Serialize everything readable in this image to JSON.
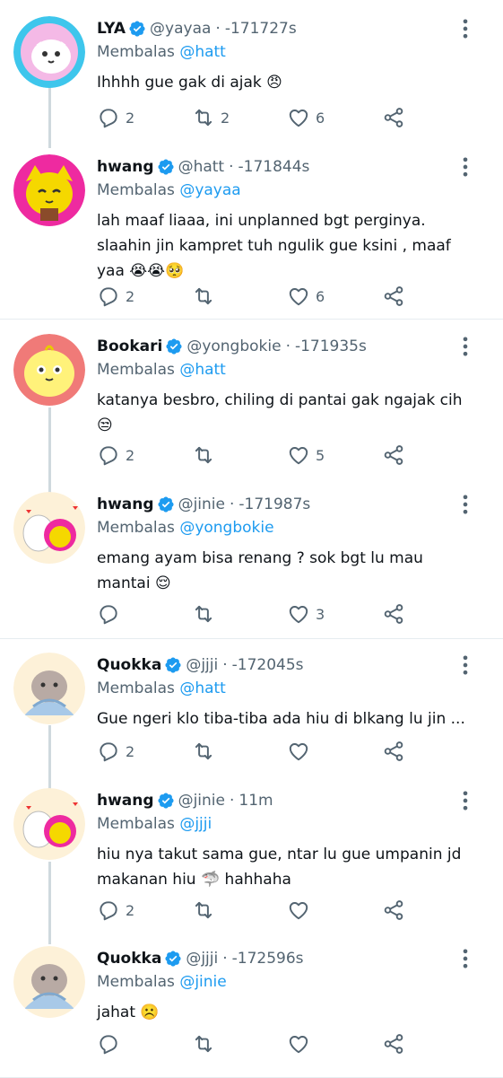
{
  "reply_prefix": "Membalas",
  "tweets": [
    {
      "name": "LYA",
      "handle": "@yayaa",
      "time": "-171727s",
      "reply_to": "@hatt",
      "text": "Ihhhh gue gak di ajak 😠",
      "replies": "2",
      "retweets": "2",
      "likes": "6"
    },
    {
      "name": "hwang",
      "handle": "@hatt",
      "time": "-171844s",
      "reply_to": "@yayaa",
      "text": "lah maaf liaaa, ini unplanned bgt perginya.\nslaahin jin kampret tuh ngulik gue ksini , maaf\nyaa 😭😭🥺",
      "replies": "2",
      "retweets": "",
      "likes": "6"
    },
    {
      "name": "Bookari",
      "handle": "@yongbokie",
      "time": "-171935s",
      "reply_to": "@hatt",
      "text": "katanya besbro, chiling di pantai gak ngajak cih\n😒",
      "replies": "2",
      "retweets": "",
      "likes": "5"
    },
    {
      "name": "hwang",
      "handle": "@jinie",
      "time": "-171987s",
      "reply_to": "@yongbokie",
      "text": "emang ayam bisa renang ? sok bgt lu mau\nmantai 😌",
      "replies": "",
      "retweets": "",
      "likes": "3"
    },
    {
      "name": "Quokka",
      "handle": "@jjji",
      "time": "-172045s",
      "reply_to": "@hatt",
      "text": "Gue ngeri klo tiba-tiba ada hiu di blkang lu jin ...",
      "replies": "2",
      "retweets": "",
      "likes": ""
    },
    {
      "name": "hwang",
      "handle": "@jinie",
      "time": "11m",
      "reply_to": "@jjji",
      "text": "hiu nya takut sama gue, ntar lu gue umpanin jd\nmakanan hiu 🦈 hahhaha",
      "replies": "2",
      "retweets": "",
      "likes": ""
    },
    {
      "name": "Quokka",
      "handle": "@jjji",
      "time": "-172596s",
      "reply_to": "@jinie",
      "text": "jahat ☹️",
      "replies": "",
      "retweets": "",
      "likes": ""
    }
  ],
  "colors": {
    "accent": "#1d9bf0",
    "muted": "#536471",
    "divider": "#e6ecf0",
    "thread_line": "#cfd9de"
  }
}
